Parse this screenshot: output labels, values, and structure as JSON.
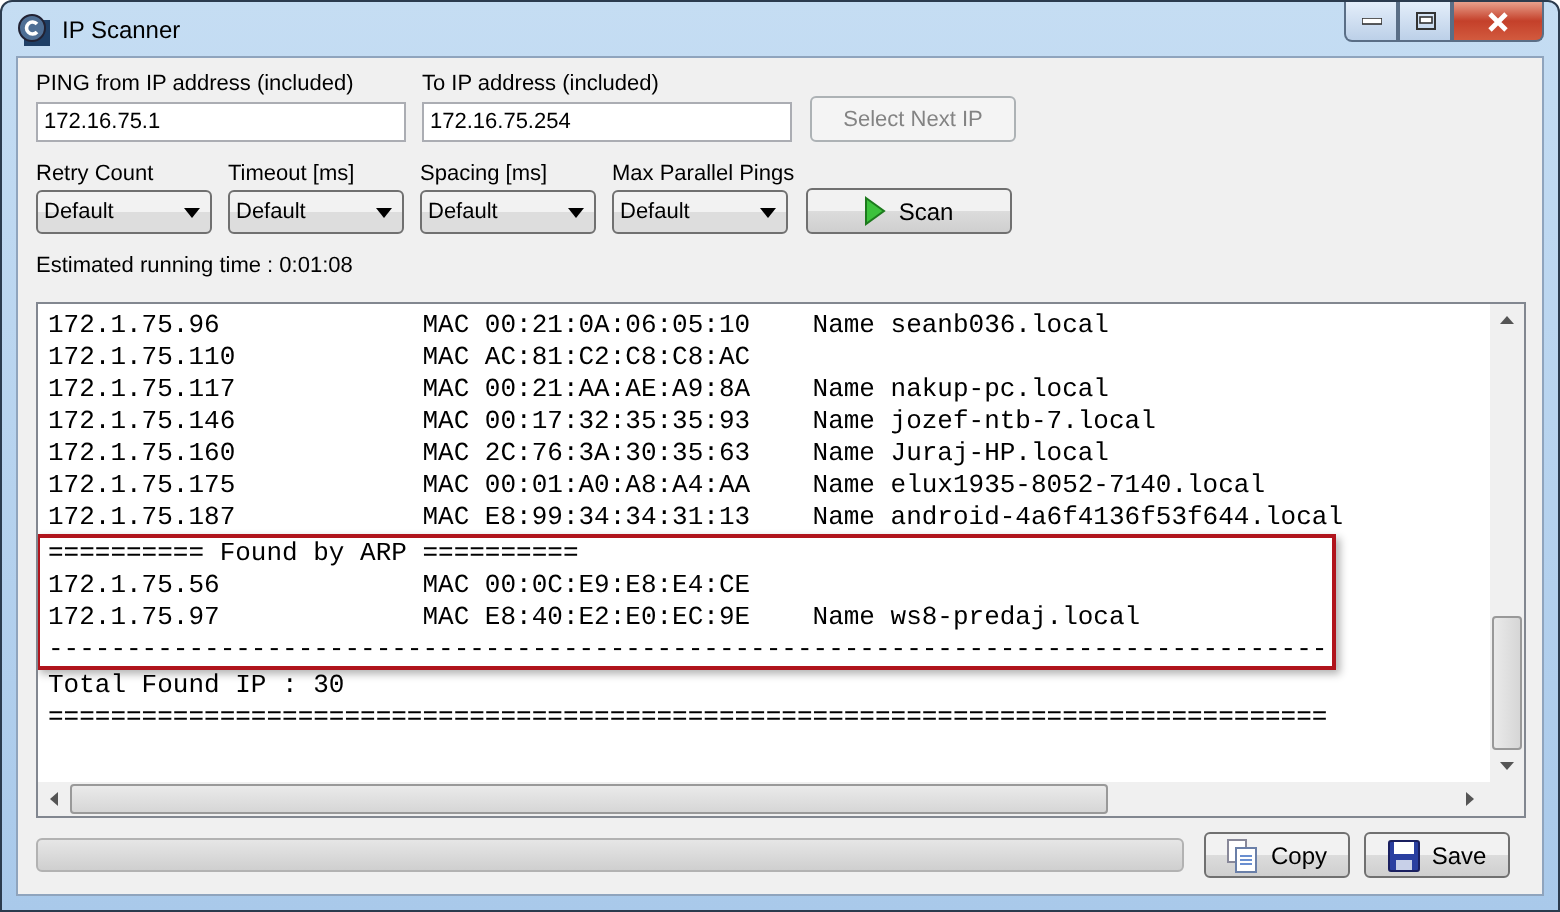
{
  "window": {
    "title": "IP Scanner"
  },
  "from_field": {
    "label": "PING from IP address (included)",
    "value": "172.16.75.1"
  },
  "to_field": {
    "label": "To IP address (included)",
    "value": "172.16.75.254"
  },
  "select_next_button": {
    "label": "Select Next IP",
    "disabled": true
  },
  "dropdowns": [
    {
      "label": "Retry Count",
      "value": "Default"
    },
    {
      "label": "Timeout [ms]",
      "value": "Default"
    },
    {
      "label": "Spacing [ms]",
      "value": "Default"
    },
    {
      "label": "Max Parallel Pings",
      "value": "Default"
    }
  ],
  "scan_button": {
    "label": "Scan"
  },
  "estimate": "Estimated running time : 0:01:08",
  "log": [
    {
      "kind": "line",
      "text": "172.1.75.96             MAC 00:21:0A:06:05:10    Name seanb036.local"
    },
    {
      "kind": "line",
      "text": "172.1.75.110            MAC AC:81:C2:C8:C8:AC"
    },
    {
      "kind": "line",
      "text": "172.1.75.117            MAC 00:21:AA:AE:A9:8A    Name nakup-pc.local"
    },
    {
      "kind": "line",
      "text": "172.1.75.146            MAC 00:17:32:35:35:93    Name jozef-ntb-7.local"
    },
    {
      "kind": "line",
      "text": "172.1.75.160            MAC 2C:76:3A:30:35:63    Name Juraj-HP.local"
    },
    {
      "kind": "line",
      "text": "172.1.75.175            MAC 00:01:A0:A8:A4:AA    Name elux1935-8052-7140.local"
    },
    {
      "kind": "line",
      "text": "172.1.75.187            MAC E8:99:34:34:31:13    Name android-4a6f4136f53f644.local"
    },
    {
      "kind": "highlight",
      "lines": [
        "========== Found by ARP ==========",
        "172.1.75.56             MAC 00:0C:E9:E8:E4:CE",
        "172.1.75.97             MAC E8:40:E2:E0:EC:9E    Name ws8-predaj.local",
        "----------------------------------------------------------------------------------"
      ]
    },
    {
      "kind": "line",
      "text": "Total Found IP : 30"
    },
    {
      "kind": "line",
      "text": "=================================================================================="
    }
  ],
  "progress": {
    "level": 0
  },
  "copy_button": {
    "label": "Copy"
  },
  "save_button": {
    "label": "Save"
  }
}
